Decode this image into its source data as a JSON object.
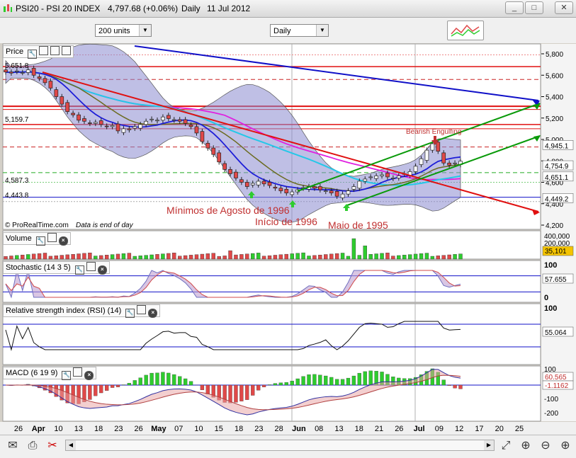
{
  "window": {
    "title": "PSI20 - PSI 20 INDEX",
    "price": "4,797.68 (+0.06%)",
    "period": "Daily",
    "date": "11 Jul 2012",
    "minimize": "_",
    "maximize": "□",
    "close": "✕"
  },
  "toolbar": {
    "units_select": "200 units",
    "period_select": "Daily"
  },
  "panes": {
    "price": {
      "title": "Price"
    },
    "volume": {
      "title": "Volume"
    },
    "stochastic": {
      "title": "Stochastic (14 3 5)"
    },
    "rsi": {
      "title": "Relative strength index (RSI) (14)"
    },
    "macd": {
      "title": "MACD (6 19 9)"
    }
  },
  "price_axis": {
    "ticks": [
      "5,800",
      "5,600",
      "5,400",
      "5,200",
      "5,000",
      "4,800",
      "4,600",
      "4,400",
      "4,200"
    ],
    "badges": {
      "current": "4,754.9",
      "level_4945": "4,945.1",
      "level_4651": "4,651.1",
      "level_4449": "4,449.2"
    }
  },
  "left_levels": [
    "5,651.8",
    "5,159.7",
    "4,587.3",
    "4,443.8"
  ],
  "annotations": {
    "bearish": "Bearish Engulfing",
    "minimos": "Mínimos de Agosto de 1996",
    "inicio": "Início de 1996",
    "maio": "Maio de 1995",
    "copyright": "© ProRealTime.com",
    "eod": "Data is end of day"
  },
  "volume_axis": {
    "top": "400,000",
    "mid": "200,000",
    "zero": "0",
    "current": "35,101"
  },
  "stoch_axis": {
    "top": "100",
    "zero": "0",
    "current": "57.655"
  },
  "rsi_axis": {
    "top": "100",
    "current": "55.064"
  },
  "macd_axis": {
    "t100": "100",
    "tm100": "-100",
    "tm200": "-200",
    "current1": "60.565",
    "current2": "-1.1162"
  },
  "date_labels": [
    {
      "label": "26",
      "bold": false
    },
    {
      "label": "Apr",
      "bold": true
    },
    {
      "label": "10",
      "bold": false
    },
    {
      "label": "13",
      "bold": false
    },
    {
      "label": "18",
      "bold": false
    },
    {
      "label": "23",
      "bold": false
    },
    {
      "label": "26",
      "bold": false
    },
    {
      "label": "May",
      "bold": true
    },
    {
      "label": "07",
      "bold": false
    },
    {
      "label": "10",
      "bold": false
    },
    {
      "label": "15",
      "bold": false
    },
    {
      "label": "18",
      "bold": false
    },
    {
      "label": "23",
      "bold": false
    },
    {
      "label": "28",
      "bold": false
    },
    {
      "label": "Jun",
      "bold": true
    },
    {
      "label": "08",
      "bold": false
    },
    {
      "label": "13",
      "bold": false
    },
    {
      "label": "18",
      "bold": false
    },
    {
      "label": "21",
      "bold": false
    },
    {
      "label": "26",
      "bold": false
    },
    {
      "label": "Jul",
      "bold": true
    },
    {
      "label": "09",
      "bold": false
    },
    {
      "label": "12",
      "bold": false
    },
    {
      "label": "17",
      "bold": false
    },
    {
      "label": "20",
      "bold": false
    },
    {
      "label": "25",
      "bold": false
    }
  ],
  "colors": {
    "bull": "#2ecc2e",
    "bear": "#e04848",
    "band_fill": "#8a8ad0",
    "ma_short": "#1e1ed8",
    "ma_cyan": "#24c8e8",
    "ma_magenta": "#e020e0",
    "ma_olive": "#6b6b20",
    "trend_red": "#e01010",
    "trend_blue": "#1010c8",
    "trend_green": "#0a9a0a"
  },
  "chart_data": {
    "type": "candlestick",
    "y_range": [
      4150,
      5900
    ],
    "closes": [
      5630,
      5620,
      5640,
      5625,
      5650,
      5600,
      5570,
      5530,
      5480,
      5400,
      5330,
      5260,
      5230,
      5180,
      5170,
      5150,
      5160,
      5140,
      5120,
      5130,
      5080,
      5100,
      5090,
      5120,
      5140,
      5170,
      5190,
      5180,
      5210,
      5195,
      5185,
      5170,
      5150,
      5120,
      5060,
      4980,
      4920,
      4860,
      4790,
      4720,
      4680,
      4640,
      4600,
      4560,
      4590,
      4610,
      4585,
      4570,
      4545,
      4520,
      4500,
      4510,
      4530,
      4550,
      4560,
      4545,
      4530,
      4520,
      4500,
      4470,
      4490,
      4520,
      4560,
      4610,
      4630,
      4650,
      4660,
      4670,
      4650,
      4640,
      4660,
      4680,
      4700,
      4750,
      4820,
      4900,
      4960,
      4890,
      4780,
      4760,
      4780,
      4797
    ]
  }
}
